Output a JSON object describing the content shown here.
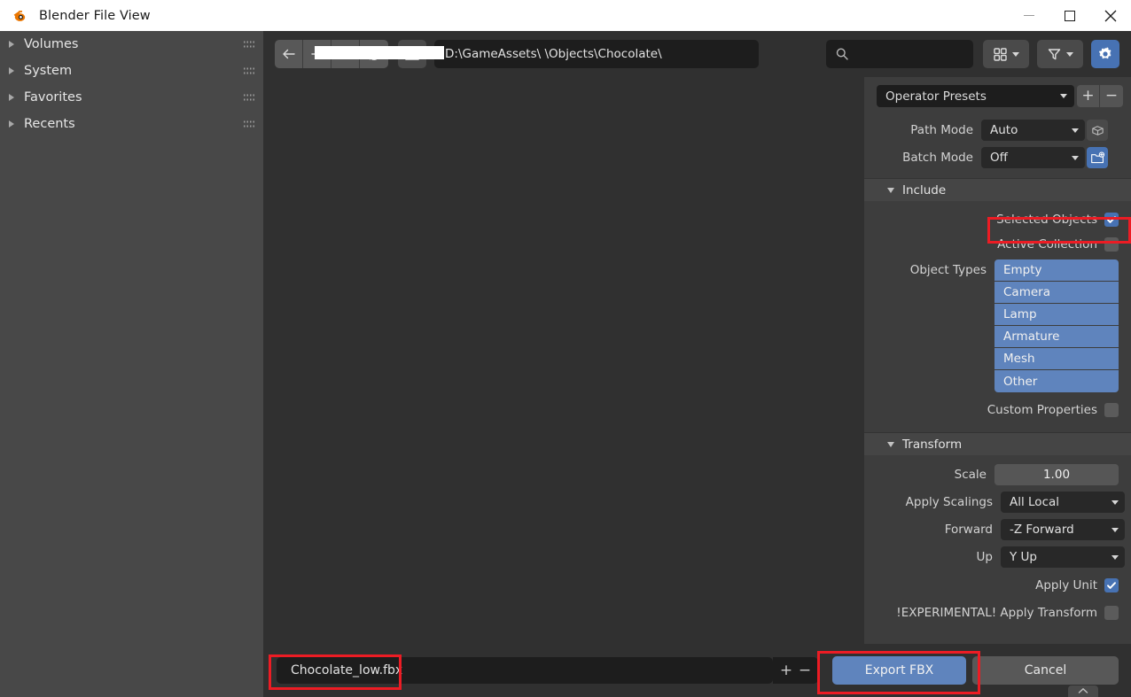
{
  "window": {
    "title": "Blender File View",
    "logo_icon": "blender-logo-icon",
    "minimize_label": "Minimize",
    "maximize_label": "Maximize",
    "close_label": "Close",
    "accent_blue": "#4772b3",
    "highlight_red": "#ec1c24"
  },
  "sidebar": {
    "items": [
      {
        "label": "Volumes",
        "icon": "triangle-right-icon",
        "grip": "drag-grip-icon"
      },
      {
        "label": "System",
        "icon": "triangle-right-icon",
        "grip": "drag-grip-icon"
      },
      {
        "label": "Favorites",
        "icon": "triangle-right-icon",
        "grip": "drag-grip-icon"
      },
      {
        "label": "Recents",
        "icon": "triangle-right-icon",
        "grip": "drag-grip-icon"
      }
    ]
  },
  "toolbar": {
    "back_icon": "arrow-left-icon",
    "forward_icon": "arrow-right-icon",
    "parent_icon": "arrow-up-icon",
    "refresh_icon": "refresh-icon",
    "new_directory_icon": "new-folder-icon",
    "path_value": "D:\\GameAssets\\                    \\Objects\\Chocolate\\",
    "path_prefix": "D:\\GameAssets\\",
    "path_suffix": "\\Objects\\Chocolate\\",
    "search_placeholder": "",
    "search_value": "",
    "search_icon": "search-icon",
    "display_mode_icon": "grid-view-icon",
    "display_mode_chevron": "chevron-down-icon",
    "filter_icon": "funnel-filter-icon",
    "filter_chevron": "chevron-down-icon",
    "options_icon": "gear-icon"
  },
  "properties": {
    "preset": {
      "label": "Operator Presets",
      "chevron": "chevron-down-icon",
      "add_label": "+",
      "remove_label": "−"
    },
    "path_mode": {
      "label": "Path Mode",
      "value": "Auto",
      "chevron": "chevron-down-icon",
      "side_icon": "cube-relative-path-icon"
    },
    "batch_mode": {
      "label": "Batch Mode",
      "value": "Off",
      "chevron": "chevron-down-icon",
      "side_icon": "new-folder-icon"
    },
    "include": {
      "header": "Include",
      "header_icon": "triangle-down-icon",
      "selected_objects": {
        "label": "Selected Objects",
        "checked": true
      },
      "active_collection": {
        "label": "Active Collection",
        "checked": false
      },
      "object_types_label": "Object Types",
      "object_types": [
        {
          "label": "Empty",
          "selected": true
        },
        {
          "label": "Camera",
          "selected": true
        },
        {
          "label": "Lamp",
          "selected": true
        },
        {
          "label": "Armature",
          "selected": true
        },
        {
          "label": "Mesh",
          "selected": true
        },
        {
          "label": "Other",
          "selected": true
        }
      ],
      "custom_properties": {
        "label": "Custom Properties",
        "checked": false
      }
    },
    "transform": {
      "header": "Transform",
      "header_icon": "triangle-down-icon",
      "scale": {
        "label": "Scale",
        "value": "1.00"
      },
      "apply_scalings": {
        "label": "Apply Scalings",
        "value": "All Local",
        "chevron": "chevron-down-icon"
      },
      "forward": {
        "label": "Forward",
        "value": "-Z Forward",
        "chevron": "chevron-down-icon"
      },
      "up": {
        "label": "Up",
        "value": "Y Up",
        "chevron": "chevron-down-icon"
      },
      "apply_unit": {
        "label": "Apply Unit",
        "checked": true
      },
      "apply_transform": {
        "label": "!EXPERIMENTAL! Apply Transform",
        "checked": false
      }
    }
  },
  "bottom": {
    "filename_value": "Chocolate_low.fbx",
    "filename_placeholder": "",
    "increment_label": "+",
    "decrement_label": "−",
    "export_label": "Export FBX",
    "cancel_label": "Cancel",
    "corner_chevron": "chevron-up-icon"
  }
}
